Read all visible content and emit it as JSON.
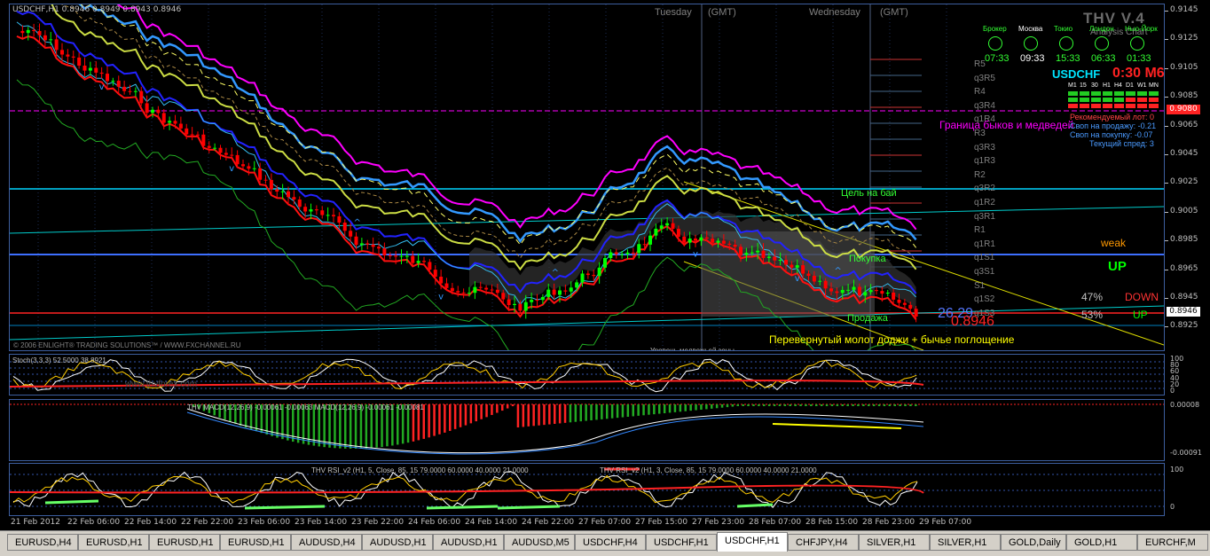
{
  "chart": {
    "symbol_header": "USDCHF,H1  0.8946 0.8949 0.8943 0.8946",
    "session_tuesday": "Tuesday",
    "session_wednesday": "Wednesday",
    "gmt": "(GMT)",
    "copyright": "© 2006 ENLIGHT® TRADING SOLUTIONS™ / WWW.FXCHANNEL.RU",
    "price_axis": [
      "0.9145",
      "0.9125",
      "0.9105",
      "0.9085",
      "0.9065",
      "0.9045",
      "0.9025",
      "0.9005",
      "0.8985",
      "0.8965",
      "0.8945",
      "0.8925"
    ],
    "tag_red": "0.9080",
    "tag_current": "0.8946",
    "annotations": {
      "bull_bear": "Граница быков и медведей",
      "buy_target": "Цель на бай",
      "buy": "Покупка",
      "sell": "Продажа",
      "pattern": "Перевернутый молот доджи + бычье поглощение",
      "hidden_bottom": "Уровень медвежьей зоны",
      "weak": "weak",
      "up_big": "UP",
      "down_pct": "47%",
      "down_label": "DOWN",
      "up_pct": "53%",
      "up_label": "UP",
      "big_price": "0.8946",
      "big_num": "26.29"
    },
    "levels": [
      "R5",
      "q3R5",
      "R4",
      "q3R4",
      "q1R4",
      "R3",
      "q3R3",
      "q1R3",
      "R2",
      "q3R2",
      "q1R2",
      "q3R1",
      "R1",
      "q1R1",
      "q1S1",
      "q3S1",
      "S1",
      "q1S2",
      "q1S3"
    ]
  },
  "panel": {
    "title": "THV V.4",
    "subtitle": "Analysis Chart",
    "clocks": [
      {
        "label": "Брокер",
        "time": "07:33"
      },
      {
        "label": "Москва",
        "time": "09:33"
      },
      {
        "label": "Токио",
        "time": "15:33"
      },
      {
        "label": "Лондон",
        "time": "06:33"
      },
      {
        "label": "Нью-Йорк",
        "time": "01:33"
      }
    ],
    "symbol": "USDCHF",
    "timer": "0:30 M6",
    "timeframes": [
      "M1",
      "15",
      "30",
      "H1",
      "H4",
      "D1",
      "W1",
      "MN"
    ],
    "lot": "Рекомендуемый лот: 0",
    "swap_sell": "Своп на продажу: -0.21",
    "swap_buy": "Своп на покупку: -0.07",
    "spread": "Текущий спред: 3"
  },
  "stoch": {
    "label": "Stoch(3,3,3) 52.5000 38.8921",
    "watermark": "www.thvforex.com",
    "axis": [
      "100",
      "80",
      "60",
      "40",
      "20",
      "0"
    ]
  },
  "macd": {
    "label": "THV MACD(12,26,9) -0.00061 -0.00063 MACD(12,26,9) -0.00061 -0.00081",
    "axis": [
      "0.00008",
      "-0.00091"
    ]
  },
  "rsi": {
    "label1": "THV RSI_v2 (H1, 5, Close, 85, 15 79.0000 60.0000 40.0000 21.0000",
    "label2": "THV RSI_v2 (H1, 3, Close, 85, 15 79.0000 60.0000 40.0000 21.0000",
    "axis": [
      "100",
      "0"
    ]
  },
  "time_axis": [
    "21 Feb 2012",
    "22 Feb 06:00",
    "22 Feb 14:00",
    "22 Feb 22:00",
    "23 Feb 06:00",
    "23 Feb 14:00",
    "23 Feb 22:00",
    "24 Feb 06:00",
    "24 Feb 14:00",
    "24 Feb 22:00",
    "27 Feb 07:00",
    "27 Feb 15:00",
    "27 Feb 23:00",
    "28 Feb 07:00",
    "28 Feb 15:00",
    "28 Feb 23:00",
    "29 Feb 07:00"
  ],
  "tabs": [
    "EURUSD,H4",
    "EURUSD,H1",
    "EURUSD,H1",
    "EURUSD,H1",
    "AUDUSD,H4",
    "AUDUSD,H1",
    "AUDUSD,H1",
    "AUDUSD,M5",
    "USDCHF,H4",
    "USDCHF,H1",
    "USDCHF,H1",
    "CHFJPY,H4",
    "SILVER,H1",
    "SILVER,H1",
    "GOLD,Daily",
    "GOLD,H1",
    "EURCHF,M"
  ],
  "active_tab_index": 10,
  "colors": {
    "bull_candle": "#00ff00",
    "bear_candle": "#ff0000",
    "accent_magenta": "#ff00ff",
    "ichimoku_yellow": "#ccdd44",
    "axis_blue": "#3d5fa0"
  }
}
